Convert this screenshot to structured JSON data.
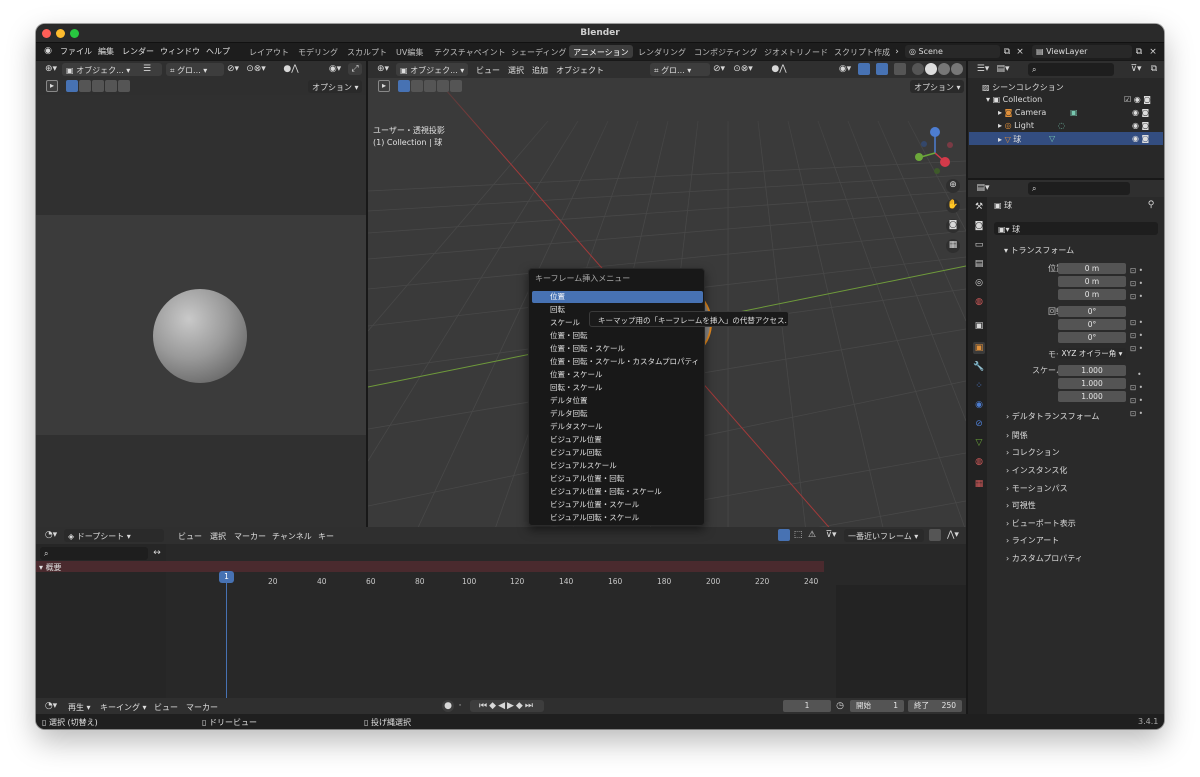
{
  "window": {
    "title": "Blender",
    "version": "3.4.1"
  },
  "topbar": {
    "menus": [
      "ファイル",
      "編集",
      "レンダー",
      "ウィンドウ",
      "ヘルプ"
    ],
    "workspaces": [
      "レイアウト",
      "モデリング",
      "スカルプト",
      "UV編集",
      "テクスチャペイント",
      "シェーディング",
      "アニメーション",
      "レンダリング",
      "コンポジティング",
      "ジオメトリノード",
      "スクリプト作成"
    ],
    "active_workspace": "アニメーション",
    "scene": "Scene",
    "view_layer": "ViewLayer"
  },
  "left_view": {
    "mode": "オブジェク...",
    "orientation": "グロ...",
    "options": "オプション"
  },
  "main_view": {
    "mode": "オブジェク...",
    "menus": [
      "ビュー",
      "選択",
      "追加",
      "オブジェクト"
    ],
    "orientation": "グロ...",
    "options": "オプション",
    "overlay_line1": "ユーザー・透視投影",
    "overlay_line2": "(1) Collection | 球"
  },
  "keyframe_menu": {
    "title": "キーフレーム挿入メニュー",
    "items": [
      "位置",
      "回転",
      "スケール",
      "位置・回転",
      "位置・回転・スケール",
      "位置・回転・スケール・カスタムプロパティ",
      "位置・スケール",
      "回転・スケール",
      "デルタ位置",
      "デルタ回転",
      "デルタスケール",
      "ビジュアル位置",
      "ビジュアル回転",
      "ビジュアルスケール",
      "ビジュアル位置・回転",
      "ビジュアル位置・回転・スケール",
      "ビジュアル位置・スケール",
      "ビジュアル回転・スケール"
    ],
    "selected": "位置",
    "tooltip": "キーマップ用の「キーフレームを挿入」の代替アクセス."
  },
  "outliner": {
    "scene_collection": "シーンコレクション",
    "collection": "Collection",
    "items": [
      "Camera",
      "Light",
      "球"
    ]
  },
  "properties": {
    "object_name": "球",
    "data_name": "球",
    "transform_label": "トランスフォーム",
    "location_label": "位置 X",
    "rotation_label": "回転 X",
    "scale_label": "スケール X",
    "y": "Y",
    "z": "Z",
    "location": [
      "0 m",
      "0 m",
      "0 m"
    ],
    "rotation": [
      "0°",
      "0°",
      "0°"
    ],
    "mode_label": "モード",
    "mode_value": "XYZ オイラー角",
    "scale": [
      "1.000",
      "1.000",
      "1.000"
    ],
    "delta": "デルタトランスフォーム",
    "panels": [
      "関係",
      "コレクション",
      "インスタンス化",
      "モーションパス",
      "可視性",
      "ビューポート表示",
      "ラインアート",
      "カスタムプロパティ"
    ]
  },
  "dopesheet": {
    "editor": "ドープシート",
    "menus": [
      "ビュー",
      "選択",
      "マーカー",
      "チャンネル",
      "キー"
    ],
    "snap": "一番近いフレーム",
    "summary": "概要",
    "current_frame": "1",
    "ticks": [
      "20",
      "40",
      "60",
      "80",
      "100",
      "120",
      "140",
      "160",
      "180",
      "200",
      "220",
      "240"
    ]
  },
  "timeline": {
    "menus": [
      "再生",
      "キーイング",
      "ビュー",
      "マーカー"
    ],
    "frame": "1",
    "start_label": "開始",
    "start": "1",
    "end_label": "終了",
    "end": "250"
  },
  "statusbar": {
    "select": "選択 (切替え)",
    "dolly": "ドリービュー",
    "lasso": "投げ縄選択"
  }
}
